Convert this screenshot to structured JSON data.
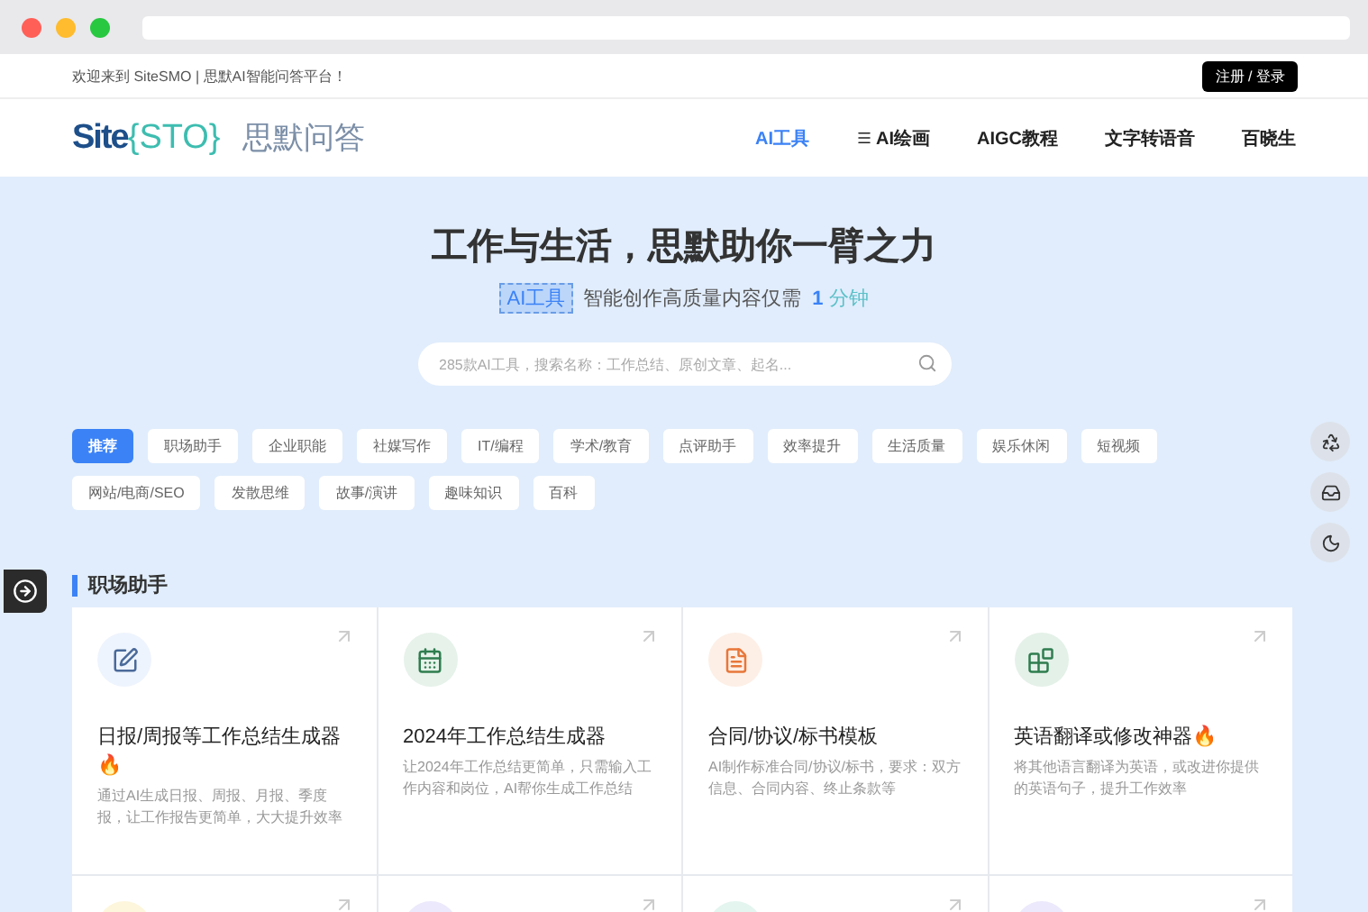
{
  "topbar": {
    "welcome": "欢迎来到 SiteSMO | 思默AI智能问答平台！",
    "login": "注册 / 登录"
  },
  "logo": {
    "site": "Site",
    "brand": "{STO}",
    "slogan": "思默问答"
  },
  "nav": [
    {
      "label": "AI工具",
      "selected": true,
      "menu_icon": false
    },
    {
      "label": "AI绘画",
      "selected": false,
      "menu_icon": true
    },
    {
      "label": "AIGC教程",
      "selected": false,
      "menu_icon": false
    },
    {
      "label": "文字转语音",
      "selected": false,
      "menu_icon": false
    },
    {
      "label": "百晓生",
      "selected": false,
      "menu_icon": false
    }
  ],
  "hero": {
    "title": "工作与生活，思默助你一臂之力",
    "badge": "AI工具",
    "subtitle": "智能创作高质量内容仅需",
    "number": "1",
    "unit": "分钟"
  },
  "search": {
    "placeholder": "285款AI工具，搜索名称：工作总结、原创文章、起名..."
  },
  "tags": [
    {
      "label": "推荐",
      "selected": true
    },
    {
      "label": "职场助手",
      "selected": false
    },
    {
      "label": "企业职能",
      "selected": false
    },
    {
      "label": "社媒写作",
      "selected": false
    },
    {
      "label": "IT/编程",
      "selected": false
    },
    {
      "label": "学术/教育",
      "selected": false
    },
    {
      "label": "点评助手",
      "selected": false
    },
    {
      "label": "效率提升",
      "selected": false
    },
    {
      "label": "生活质量",
      "selected": false
    },
    {
      "label": "娱乐休闲",
      "selected": false
    },
    {
      "label": "短视频",
      "selected": false
    },
    {
      "label": "网站/电商/SEO",
      "selected": false
    },
    {
      "label": "发散思维",
      "selected": false
    },
    {
      "label": "故事/演讲",
      "selected": false
    },
    {
      "label": "趣味知识",
      "selected": false
    },
    {
      "label": "百科",
      "selected": false
    }
  ],
  "section": {
    "title": "职场助手"
  },
  "cards": [
    {
      "kind": "edit",
      "color": "#eef4fd",
      "title": "日报/周报等工作总结生成器🔥",
      "desc": "通过AI生成日报、周报、月报、季度报，让工作报告更简单，大大提升效率"
    },
    {
      "kind": "calendar",
      "color": "#e6f2ea",
      "title": "2024年工作总结生成器",
      "desc": "让2024年工作总结更简单，只需输入工作内容和岗位，AI帮你生成工作总结"
    },
    {
      "kind": "document",
      "color": "#fdefe6",
      "title": "合同/协议/标书模板",
      "desc": "AI制作标准合同/协议/标书，要求：双方信息、合同内容、终止条款等"
    },
    {
      "kind": "blocks",
      "color": "#e4f1e8",
      "title": "英语翻译或修改神器🔥",
      "desc": "将其他语言翻译为英语，或改进你提供的英语句子，提升工作效率"
    }
  ],
  "cards_next": [
    {
      "color": "#fdf6dc"
    },
    {
      "color": "#ebe9fb"
    },
    {
      "color": "#e3f5ee"
    },
    {
      "color": "#ebe9fb"
    }
  ]
}
